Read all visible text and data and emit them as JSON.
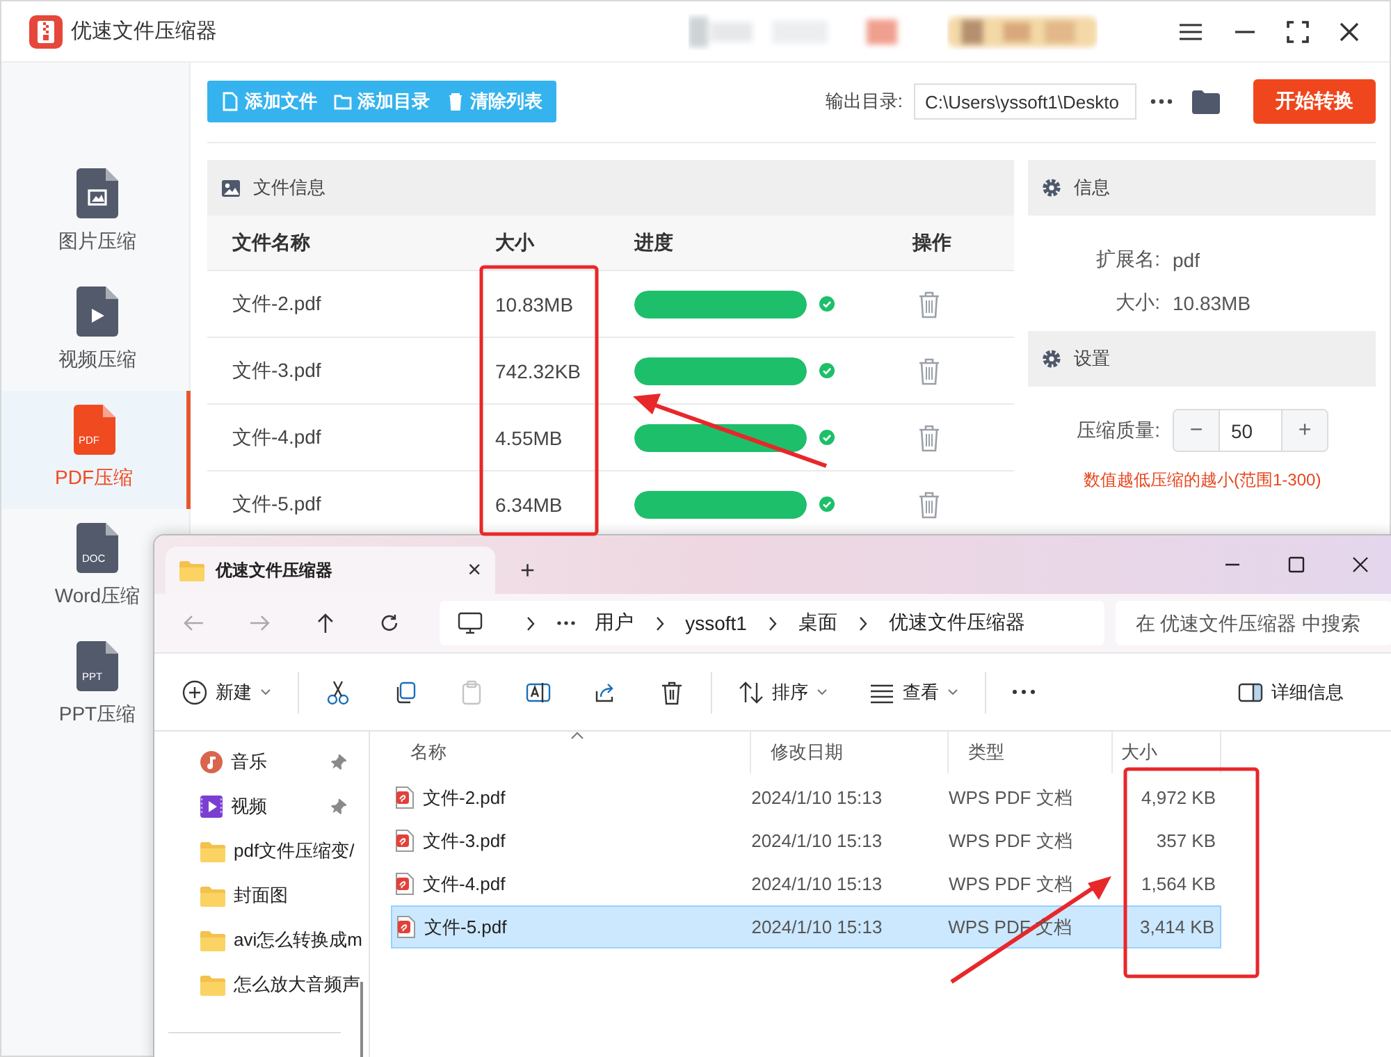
{
  "app": {
    "title": "优速文件压缩器",
    "sidebar": [
      {
        "label": "图片压缩",
        "kind": "image",
        "selected": false
      },
      {
        "label": "视频压缩",
        "kind": "video",
        "selected": false
      },
      {
        "label": "PDF压缩",
        "kind": "pdf",
        "selected": true,
        "badge": "PDF"
      },
      {
        "label": "Word压缩",
        "kind": "doc",
        "selected": false,
        "badge": "DOC"
      },
      {
        "label": "PPT压缩",
        "kind": "ppt",
        "selected": false,
        "badge": "PPT"
      }
    ],
    "toolbar": [
      {
        "label": "添加文件",
        "kind": "file"
      },
      {
        "label": "添加目录",
        "kind": "folder"
      },
      {
        "label": "清除列表",
        "kind": "trash"
      }
    ],
    "output_dir": {
      "label": "输出目录:",
      "value": "C:\\Users\\yssoft1\\Deskto"
    },
    "start_button": "开始转换",
    "file_panel": {
      "title": "文件信息",
      "columns": [
        "文件名称",
        "大小",
        "进度",
        "操作"
      ],
      "rows": [
        {
          "name": "文件-2.pdf",
          "size": "10.83MB",
          "level": 1,
          "done": true
        },
        {
          "name": "文件-3.pdf",
          "size": "742.32KB",
          "level": 1,
          "done": true
        },
        {
          "name": "文件-4.pdf",
          "size": "4.55MB",
          "level": 1,
          "done": true
        },
        {
          "name": "文件-5.pdf",
          "size": "6.34MB",
          "level": 1,
          "done": true
        }
      ]
    },
    "info": {
      "title": "信息",
      "fields": [
        {
          "label": "扩展名:",
          "value": "pdf"
        },
        {
          "label": "大小:",
          "value": "10.83MB"
        }
      ]
    },
    "settings": {
      "title": "设置",
      "quality": {
        "label": "压缩质量:",
        "minus": "−",
        "value": "50",
        "plus": "+"
      },
      "hint": "数值越低压缩的越小(范围1-300)"
    }
  },
  "explorer": {
    "tab": {
      "title": "优速文件压缩器",
      "close": "×"
    },
    "new_tab": "+",
    "breadcrumb": [
      "用户",
      "yssoft1",
      "桌面",
      "优速文件压缩器"
    ],
    "search": {
      "placeholder": "在 优速文件压缩器 中搜索"
    },
    "toolbar": [
      {
        "kind": "new",
        "label": "新建",
        "disabled": false
      },
      {
        "kind": "cut",
        "disabled": false
      },
      {
        "kind": "copy",
        "disabled": false
      },
      {
        "kind": "paste",
        "disabled": true
      },
      {
        "kind": "rename",
        "disabled": false
      },
      {
        "kind": "share",
        "disabled": false
      },
      {
        "kind": "delete",
        "disabled": false
      },
      {
        "kind": "sort",
        "label": "排序",
        "disabled": false
      },
      {
        "kind": "view",
        "label": "查看",
        "disabled": false
      },
      {
        "kind": "more",
        "disabled": false
      },
      {
        "kind": "details",
        "label": "详细信息",
        "disabled": false
      }
    ],
    "nav": [
      {
        "label": "音乐",
        "kind": "music",
        "pinned": true
      },
      {
        "label": "视频",
        "kind": "video",
        "pinned": true
      },
      {
        "label": "pdf文件压缩变/",
        "kind": "folder",
        "pinned": false
      },
      {
        "label": "封面图",
        "kind": "folder",
        "pinned": false
      },
      {
        "label": "avi怎么转换成m",
        "kind": "folder",
        "pinned": false
      },
      {
        "label": "怎么放大音频声",
        "kind": "folder",
        "pinned": false
      }
    ],
    "columns": [
      "名称",
      "修改日期",
      "类型",
      "大小"
    ],
    "files": [
      {
        "name": "文件-2.pdf",
        "date": "2024/1/10 15:13",
        "type": "WPS PDF 文档",
        "size": "4,972 KB",
        "selected": false
      },
      {
        "name": "文件-3.pdf",
        "date": "2024/1/10 15:13",
        "type": "WPS PDF 文档",
        "size": "357 KB",
        "selected": false
      },
      {
        "name": "文件-4.pdf",
        "date": "2024/1/10 15:13",
        "type": "WPS PDF 文档",
        "size": "1,564 KB",
        "selected": false
      },
      {
        "name": "文件-5.pdf",
        "date": "2024/1/10 15:13",
        "type": "WPS PDF 文档",
        "size": "3,414 KB",
        "selected": true
      }
    ]
  }
}
